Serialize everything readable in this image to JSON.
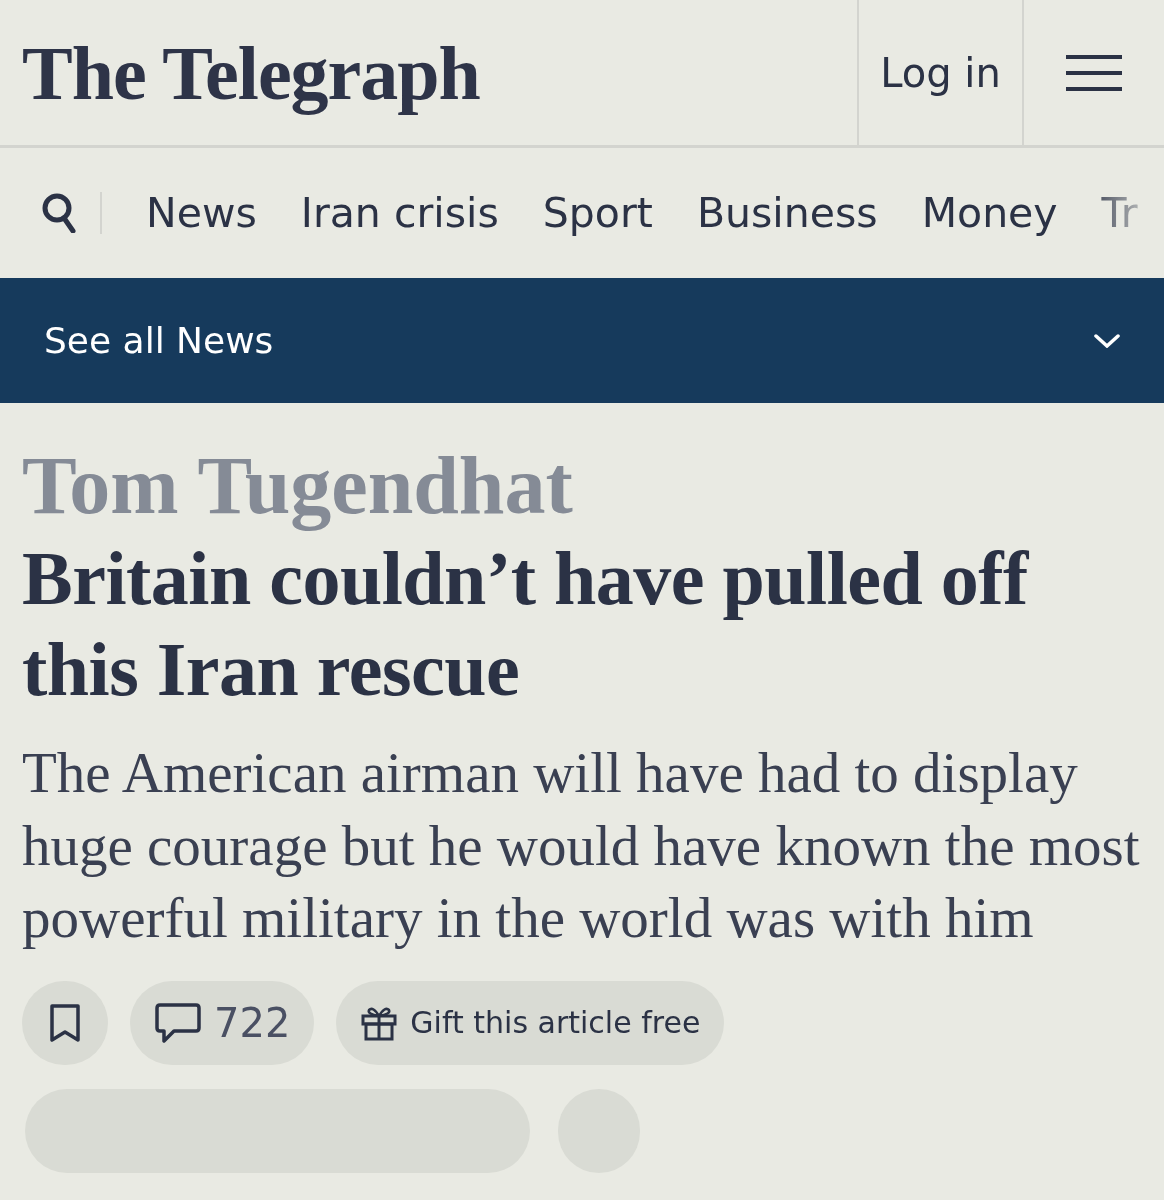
{
  "header": {
    "logo": "The Telegraph",
    "login": "Log in"
  },
  "nav": {
    "items": [
      "News",
      "Iran crisis",
      "Sport",
      "Business",
      "Money",
      "Tr"
    ]
  },
  "section_bar": {
    "label": "See all News"
  },
  "article": {
    "author": "Tom Tugendhat",
    "headline": "Britain couldn’t have pulled off this Iran rescue",
    "standfirst": "The American airman will have had to display huge courage but he would have known the most powerful military in the world was with him"
  },
  "actions": {
    "comments": "722",
    "gift": "Gift this article free"
  }
}
